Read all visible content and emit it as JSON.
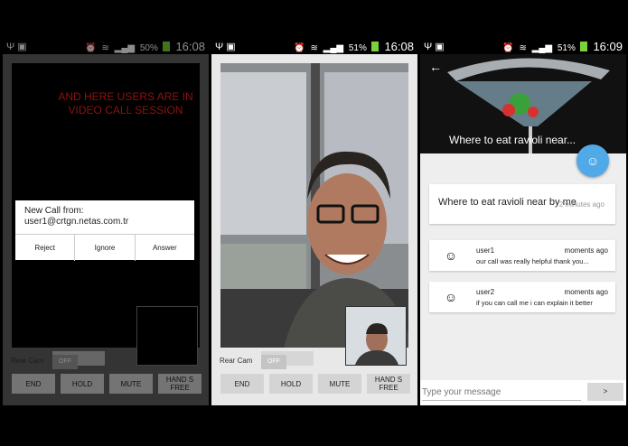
{
  "screens": [
    {
      "status": {
        "time": "16:08",
        "battery": "50%"
      },
      "overlay_text_line1": "AND HERE USERS ARE IN",
      "overlay_text_line2": "VIDEO CALL SESSION",
      "incoming_dialog": {
        "title": "New Call from:",
        "caller": "user1@crtgn.netas.com.tr",
        "buttons": [
          "Reject",
          "Ignore",
          "Answer"
        ]
      },
      "rear_cam_label": "Rear Cam",
      "rear_cam_toggle": "OFF",
      "controls": [
        "END",
        "HOLD",
        "MUTE",
        "HAND S FREE"
      ]
    },
    {
      "status": {
        "time": "16:08",
        "battery": "51%"
      },
      "rear_cam_label": "Rear Cam",
      "rear_cam_toggle": "OFF",
      "controls": [
        "END",
        "HOLD",
        "MUTE",
        "HAND S FREE"
      ]
    },
    {
      "status": {
        "time": "16:09",
        "battery": "51%"
      },
      "header_title": "Where to eat ravioli near...",
      "question": "Where to eat ravioli near by me",
      "question_time": "2 minutes ago",
      "messages": [
        {
          "user": "user1",
          "time": "moments ago",
          "text": "our call was really helpful thank you..."
        },
        {
          "user": "user2",
          "time": "moments ago",
          "text": "if you can call me i can explain it better"
        }
      ],
      "input_placeholder": "Type your message",
      "send_label": ">"
    }
  ]
}
